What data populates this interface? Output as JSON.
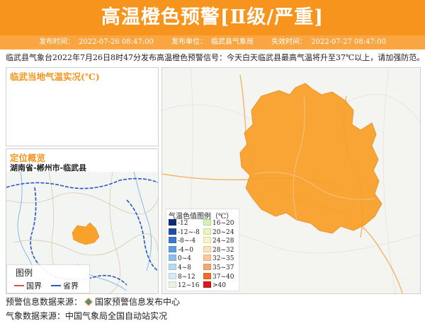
{
  "header": {
    "title": "高温橙色预警[Ⅱ级/严重]",
    "bg_color": "#f7941d",
    "publish_time_label": "发布时间：",
    "publish_time": "2022-07-26 08:47:00",
    "publisher_label": "发布单位：",
    "publisher": "临武县气象局",
    "expire_label": "失效时间：",
    "expire_time": "2022-07-27 08:47:00"
  },
  "alert_text": "临武县气象台2022年7月26日8时47分发布高温橙色预警信号：今天白天临武县最高气温将升至37℃以上，请加强防范。",
  "temp_panel": {
    "title": "临武当地气温实况(℃)"
  },
  "location_panel": {
    "title": "定位概览",
    "path": "湖南省-郴州市-临武县",
    "legend": {
      "title": "图例",
      "items": [
        {
          "label": "国界",
          "color": "#d9534f"
        },
        {
          "label": "省界",
          "color": "#2b57c9"
        }
      ]
    }
  },
  "temp_legend": {
    "title": "气温色值图例（℃）",
    "items": [
      {
        "label": "-12",
        "color": "#0b2c7a"
      },
      {
        "label": "16~20",
        "color": "#d6f2b3"
      },
      {
        "label": "-12~-8",
        "color": "#1f4fa8"
      },
      {
        "label": "20~24",
        "color": "#eaf7b8"
      },
      {
        "label": "-8~-4",
        "color": "#3b78cc"
      },
      {
        "label": "24~28",
        "color": "#fbf4c1"
      },
      {
        "label": "-4~0",
        "color": "#5f9de0"
      },
      {
        "label": "28~32",
        "color": "#fde3b0"
      },
      {
        "label": "0~4",
        "color": "#8cc0ea"
      },
      {
        "label": "32~35",
        "color": "#fcc79a"
      },
      {
        "label": "4~8",
        "color": "#b5daf2"
      },
      {
        "label": "35~37",
        "color": "#f9a66b"
      },
      {
        "label": "8~12",
        "color": "#d4ebf7"
      },
      {
        "label": "37~40",
        "color": "#f26b2a"
      },
      {
        "label": "12~16",
        "color": "#e7f6e3"
      },
      {
        "label": ">40",
        "color": "#d7191c"
      }
    ]
  },
  "map": {
    "region_color": "#f9a12b"
  },
  "footer": {
    "warning_source_label": "预警信息数据来源：",
    "warning_source": "国家预警信息发布中心",
    "weather_source": "气象数据来源：中国气象局全国自动站实况"
  }
}
